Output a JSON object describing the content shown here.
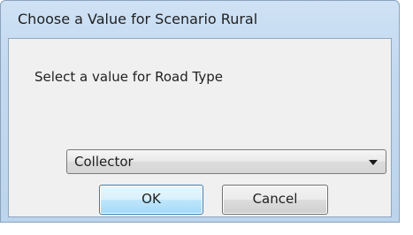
{
  "window": {
    "title": "Choose a Value for Scenario Rural"
  },
  "prompt": "Select a value for Road Type",
  "road_type_select": {
    "selected": "Collector"
  },
  "buttons": {
    "ok_label": "OK",
    "cancel_label": "Cancel"
  },
  "icons": {
    "dropdown": "chevron-down-icon"
  },
  "colors": {
    "window_frame": "#c3d9f0",
    "client_background": "#f0f0f0",
    "default_button_border": "#3c7fb1"
  }
}
